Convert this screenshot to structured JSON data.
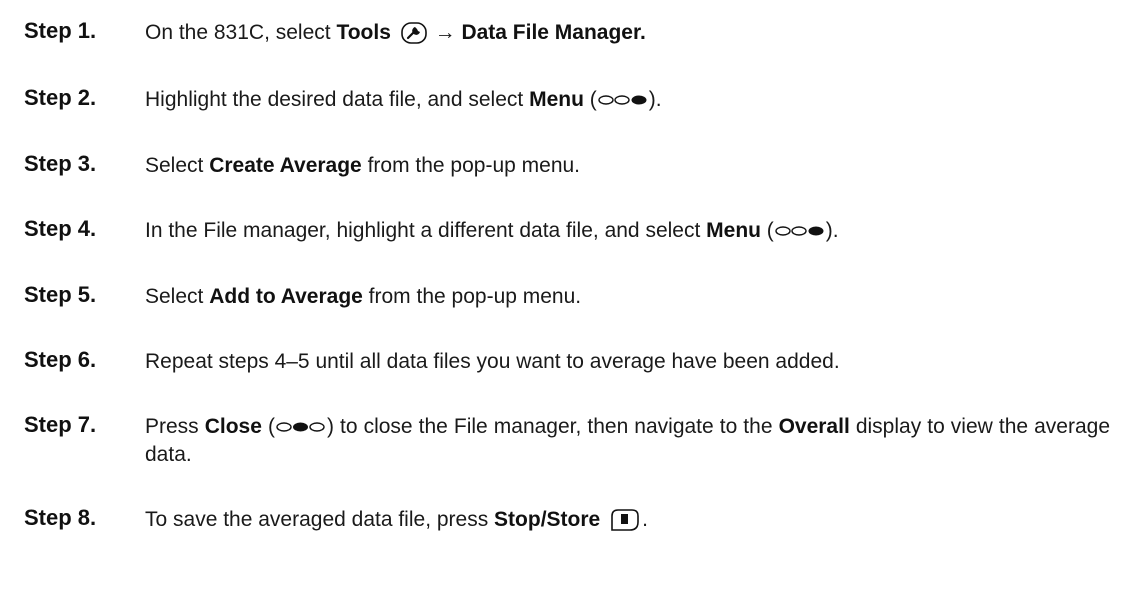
{
  "steps": [
    {
      "label": "Step 1.",
      "parts": [
        "On the 831C, select ",
        "Tools",
        " ",
        "→ ",
        "Data File Manager."
      ]
    },
    {
      "label": "Step 2.",
      "parts": [
        "Highlight the desired data file, and select ",
        "Menu",
        " (",
        ")."
      ],
      "softkey": "right"
    },
    {
      "label": "Step 3.",
      "parts": [
        "Select ",
        "Create Average",
        " from the pop-up menu."
      ]
    },
    {
      "label": "Step 4.",
      "parts": [
        "In the File manager, highlight a different data file, and select ",
        "Menu",
        " (",
        ")."
      ],
      "softkey": "right"
    },
    {
      "label": "Step 5.",
      "parts": [
        "Select ",
        "Add to Average",
        " from the pop-up menu."
      ]
    },
    {
      "label": "Step 6.",
      "parts": [
        "Repeat steps 4–5 until all data files you want to average have been added."
      ]
    },
    {
      "label": "Step 7.",
      "parts": [
        "Press ",
        "Close",
        " (",
        ") to close the File manager, then navigate to the ",
        "Overall",
        " display to view the average data."
      ],
      "softkey": "middle"
    },
    {
      "label": "Step 8.",
      "parts": [
        "To save the averaged data file, press ",
        "Stop/Store",
        " ",
        "."
      ]
    }
  ],
  "icons": {
    "tools": "wrench-icon",
    "stop_store": "stop-store-key-icon",
    "softkey_menu": "softkey-right-filled-icon",
    "softkey_close": "softkey-middle-filled-icon"
  }
}
